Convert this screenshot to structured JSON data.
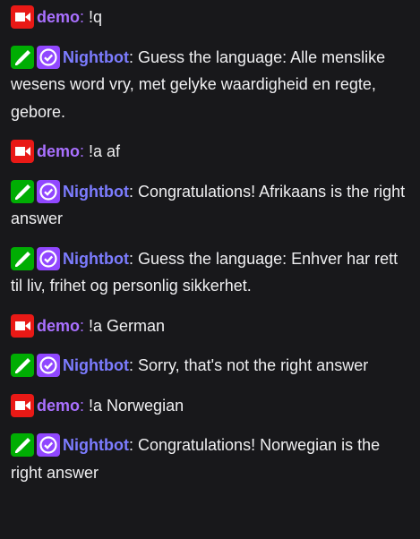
{
  "colors": {
    "background": "#18181b",
    "text": "#efeff1",
    "demo_name": "#a970ff",
    "nightbot_name": "#7c7cff",
    "broadcaster_badge": "#e91916",
    "moderator_badge": "#00ad03",
    "verified_badge": "#9147ff"
  },
  "messages": [
    {
      "user": "demo",
      "badges": [
        "broadcaster-icon"
      ],
      "text": "!q"
    },
    {
      "user": "Nightbot",
      "badges": [
        "moderator-icon",
        "verified-icon"
      ],
      "text": "Guess the language: Alle menslike wesens word vry, met gelyke waardigheid en regte, gebore."
    },
    {
      "user": "demo",
      "badges": [
        "broadcaster-icon"
      ],
      "text": "!a af"
    },
    {
      "user": "Nightbot",
      "badges": [
        "moderator-icon",
        "verified-icon"
      ],
      "text": "Congratulations! Afrikaans is the right answer"
    },
    {
      "user": "Nightbot",
      "badges": [
        "moderator-icon",
        "verified-icon"
      ],
      "text": "Guess the language: Enhver har rett til liv, frihet og personlig sikkerhet."
    },
    {
      "user": "demo",
      "badges": [
        "broadcaster-icon"
      ],
      "text": "!a German"
    },
    {
      "user": "Nightbot",
      "badges": [
        "moderator-icon",
        "verified-icon"
      ],
      "text": "Sorry, that's not the right answer"
    },
    {
      "user": "demo",
      "badges": [
        "broadcaster-icon"
      ],
      "text": "!a Norwegian"
    },
    {
      "user": "Nightbot",
      "badges": [
        "moderator-icon",
        "verified-icon"
      ],
      "text": "Congratulations! Norwegian is the right answer"
    }
  ]
}
